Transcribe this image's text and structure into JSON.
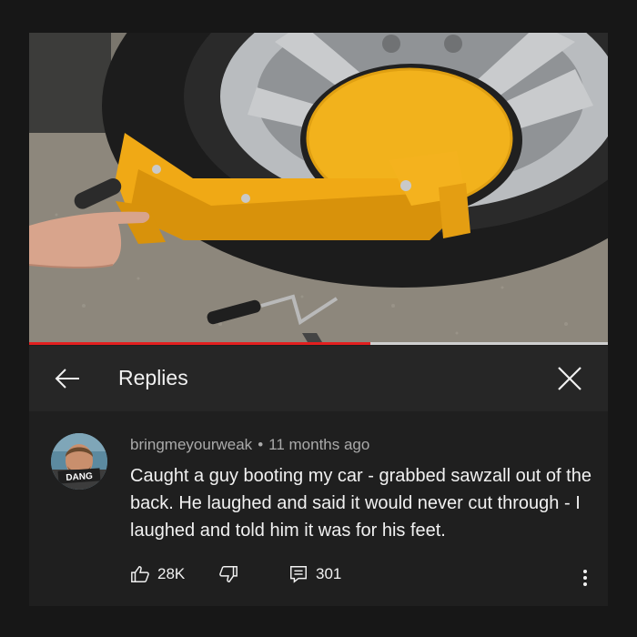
{
  "video": {
    "progress_fraction": 0.59
  },
  "header": {
    "title": "Replies"
  },
  "comment": {
    "author": "bringmeyourweak",
    "separator": "•",
    "time": "11 months ago",
    "text": "Caught a guy booting my car - grabbed sawzall out of the back.  He laughed and said it would never cut through - I laughed and told him it was for his feet.",
    "avatar_caption": "DANG",
    "likes": "28K",
    "replies": "301"
  },
  "icons": {
    "back": "arrow-left-icon",
    "close": "close-icon",
    "like": "thumbs-up-icon",
    "dislike": "thumbs-down-icon",
    "reply": "reply-comment-icon",
    "more": "more-vertical-icon"
  },
  "colors": {
    "progress": "#e21f1f",
    "background": "#171717",
    "header": "#262626"
  }
}
